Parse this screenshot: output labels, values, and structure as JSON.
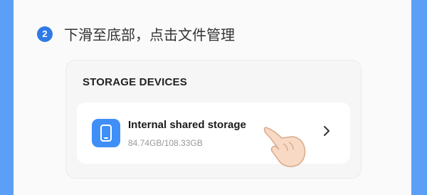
{
  "step": {
    "number": "2",
    "instruction": "下滑至底部，点击文件管理"
  },
  "section": {
    "title": "STORAGE DEVICES"
  },
  "storage_item": {
    "name": "Internal shared storage",
    "usage": "84.74GB/108.33GB"
  },
  "icons": {
    "storage": "phone-storage-icon",
    "chevron": "chevron-right-icon",
    "pointer": "tap-hand-icon"
  },
  "colors": {
    "accent": "#2f7ae6",
    "edge": "#5b9ff7",
    "icon_bg": "#3f8ff7"
  }
}
